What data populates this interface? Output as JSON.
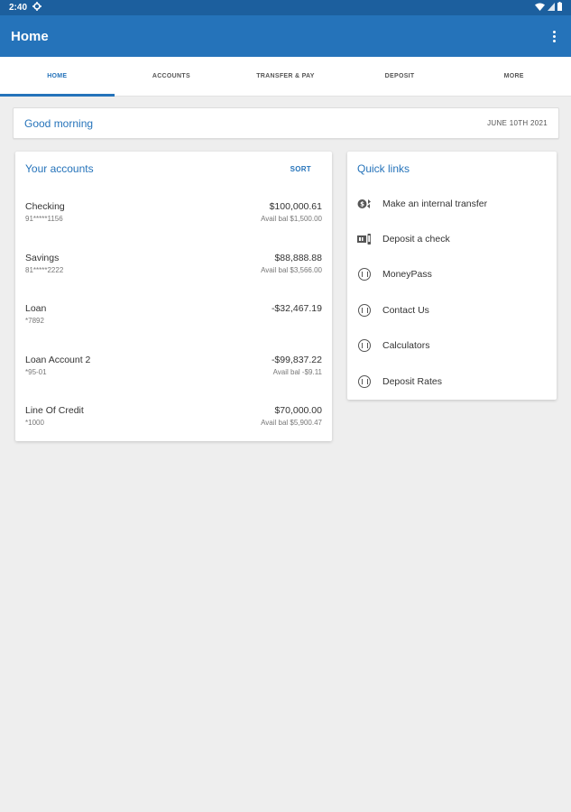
{
  "status": {
    "time": "2:40"
  },
  "appbar": {
    "title": "Home"
  },
  "tabs": [
    {
      "label": "HOME"
    },
    {
      "label": "ACCOUNTS"
    },
    {
      "label": "TRANSFER & PAY"
    },
    {
      "label": "DEPOSIT"
    },
    {
      "label": "MORE"
    }
  ],
  "greeting": {
    "text": "Good morning",
    "date": "JUNE 10TH 2021"
  },
  "accounts": {
    "title": "Your accounts",
    "sort_label": "SORT",
    "items": [
      {
        "name": "Checking",
        "number": "91*****1156",
        "balance": "$100,000.61",
        "avail": "Avail bal $1,500.00"
      },
      {
        "name": "Savings",
        "number": "81*****2222",
        "balance": "$88,888.88",
        "avail": "Avail bal $3,566.00"
      },
      {
        "name": "Loan",
        "number": "*7892",
        "balance": "-$32,467.19",
        "avail": ""
      },
      {
        "name": "Loan Account 2",
        "number": "*95-01",
        "balance": "-$99,837.22",
        "avail": "Avail bal -$9.11"
      },
      {
        "name": "Line Of Credit",
        "number": "*1000",
        "balance": "$70,000.00",
        "avail": "Avail bal $5,900.47"
      }
    ]
  },
  "quick_links": {
    "title": "Quick links",
    "items": [
      {
        "label": "Make an internal transfer",
        "icon": "transfer-icon"
      },
      {
        "label": "Deposit a check",
        "icon": "check-deposit-icon"
      },
      {
        "label": "MoneyPass",
        "icon": "map-icon"
      },
      {
        "label": "Contact Us",
        "icon": "map-icon"
      },
      {
        "label": "Calculators",
        "icon": "map-icon"
      },
      {
        "label": "Deposit Rates",
        "icon": "map-icon"
      }
    ]
  },
  "colors": {
    "status_bar": "#1c5f9e",
    "app_bar": "#2573ba",
    "accent": "#2573ba",
    "background": "#eeeeee"
  }
}
